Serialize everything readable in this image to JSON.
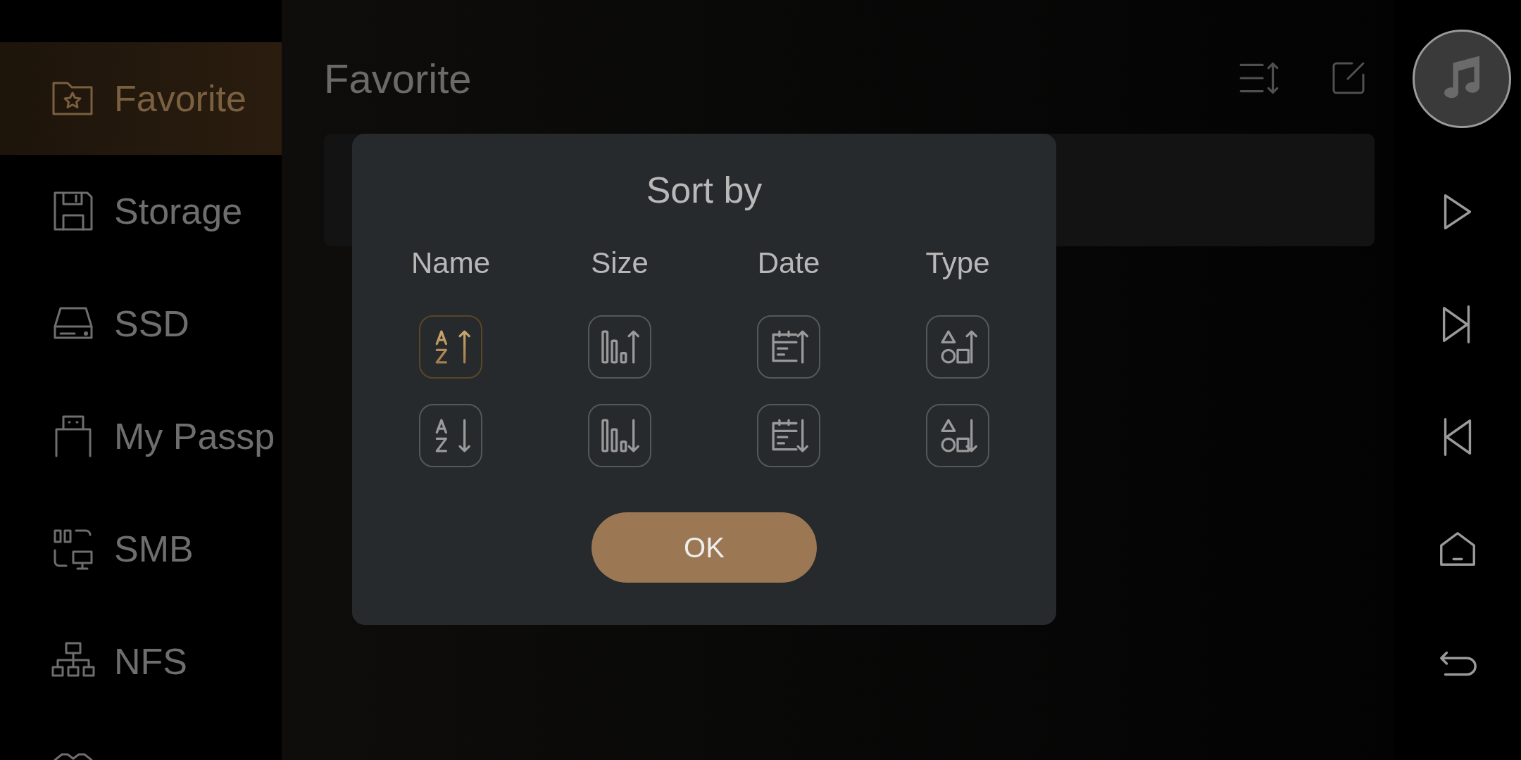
{
  "sidebar": {
    "items": [
      {
        "label": "Favorite",
        "selected": true
      },
      {
        "label": "Storage",
        "selected": false
      },
      {
        "label": "SSD",
        "selected": false
      },
      {
        "label": "My Passp",
        "selected": false
      },
      {
        "label": "SMB",
        "selected": false
      },
      {
        "label": "NFS",
        "selected": false
      }
    ]
  },
  "header": {
    "title": "Favorite"
  },
  "dialog": {
    "title": "Sort by",
    "columns": [
      {
        "label": "Name",
        "kind": "name",
        "options": [
          {
            "kind": "ascending",
            "selected": true
          },
          {
            "kind": "descending",
            "selected": false
          }
        ]
      },
      {
        "label": "Size",
        "kind": "size",
        "options": [
          {
            "kind": "ascending",
            "selected": false
          },
          {
            "kind": "descending",
            "selected": false
          }
        ]
      },
      {
        "label": "Date",
        "kind": "date",
        "options": [
          {
            "kind": "ascending",
            "selected": false
          },
          {
            "kind": "descending",
            "selected": false
          }
        ]
      },
      {
        "label": "Type",
        "kind": "type",
        "options": [
          {
            "kind": "ascending",
            "selected": false
          },
          {
            "kind": "descending",
            "selected": false
          }
        ]
      }
    ],
    "button": "OK"
  }
}
